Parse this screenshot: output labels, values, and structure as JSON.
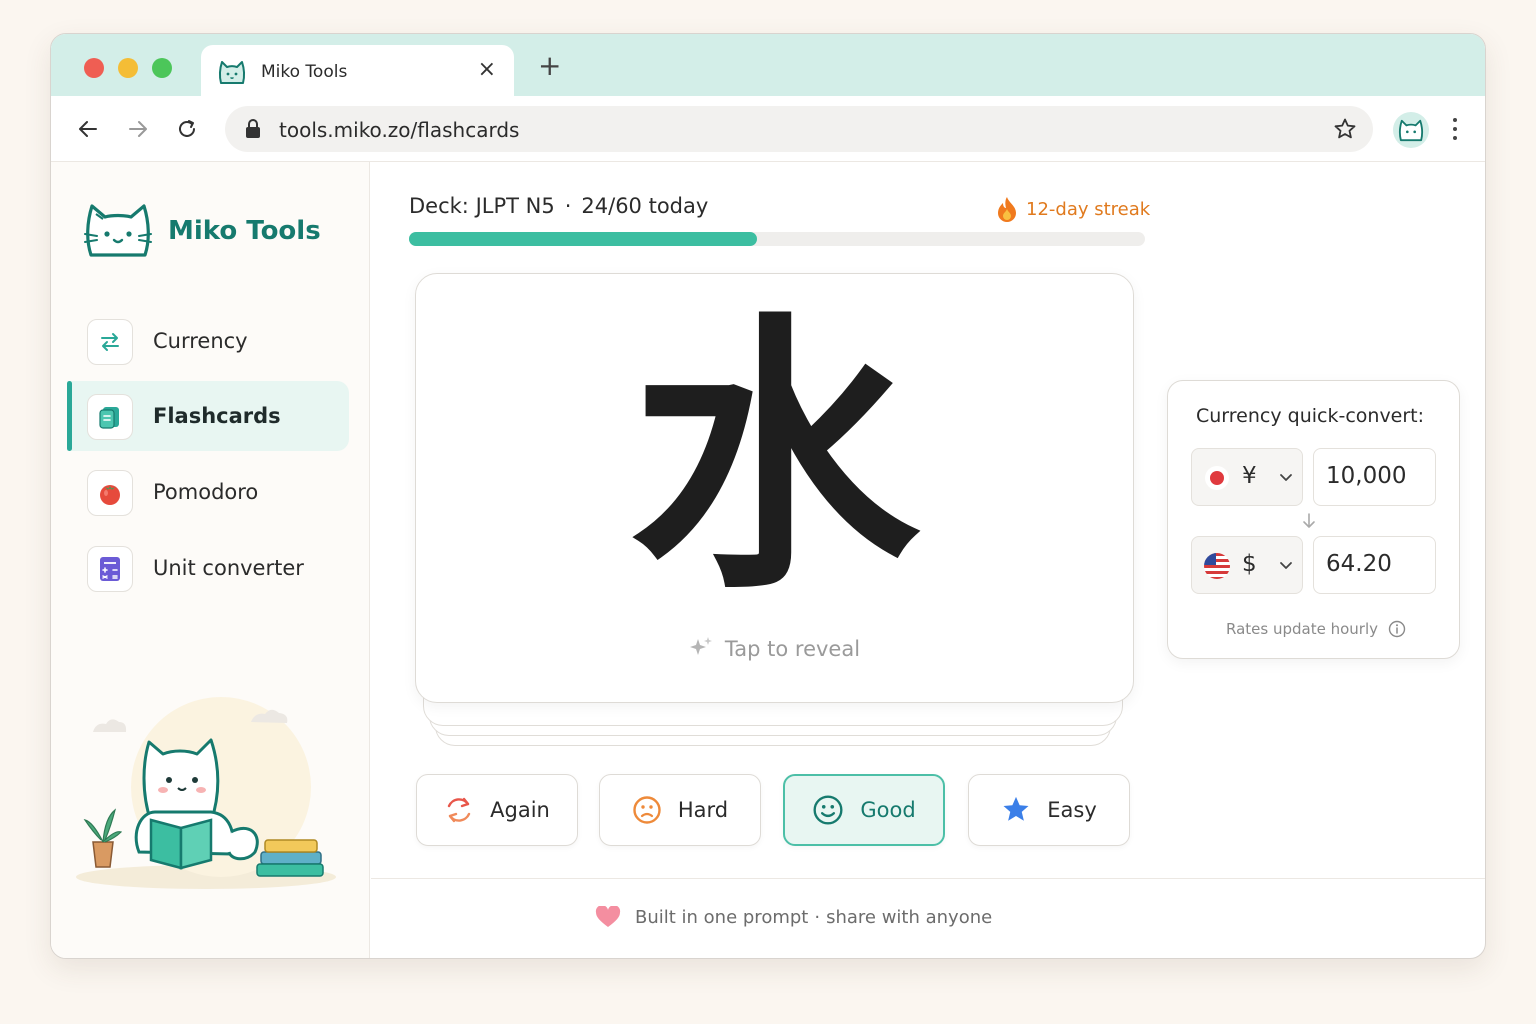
{
  "browser": {
    "tab_title": "Miko Tools",
    "tab_close": "×",
    "new_tab": "+",
    "url": "tools.miko.zo/flashcards"
  },
  "sidebar": {
    "brand": "Miko Tools",
    "items": [
      {
        "label": "Currency",
        "icon": "arrows-swap-icon",
        "active": false
      },
      {
        "label": "Flashcards",
        "icon": "flashcards-icon",
        "active": true
      },
      {
        "label": "Pomodoro",
        "icon": "tomato-icon",
        "active": false
      },
      {
        "label": "Unit converter",
        "icon": "calculator-icon",
        "active": false
      }
    ]
  },
  "deck": {
    "label": "Deck:",
    "name": "JLPT N5",
    "separator": "·",
    "today": "24/60 today",
    "streak": "12-day streak",
    "progress": 0.4733
  },
  "card": {
    "kanji": "水",
    "reveal_hint": "Tap to reveal"
  },
  "grades": [
    {
      "label": "Again",
      "icon": "refresh-icon"
    },
    {
      "label": "Hard",
      "icon": "frown-face-icon"
    },
    {
      "label": "Good",
      "icon": "smile-face-icon",
      "selected": true
    },
    {
      "label": "Easy",
      "icon": "star-icon"
    }
  ],
  "converter": {
    "title": "Currency quick-convert:",
    "from": {
      "symbol": "¥",
      "flag": "japan-flag-icon",
      "amount": "10,000"
    },
    "to": {
      "symbol": "$",
      "flag": "us-flag-icon",
      "amount": "64.20"
    },
    "note": "Rates update hourly"
  },
  "footer": {
    "left": "Built in one prompt",
    "separator": "·",
    "right": "share with anyone"
  },
  "colors": {
    "accent": "#2aa898",
    "brand": "#167a6e",
    "tab_strip": "#d3eee8",
    "streak": "#e07a1e",
    "progress": "#3cbea1"
  }
}
